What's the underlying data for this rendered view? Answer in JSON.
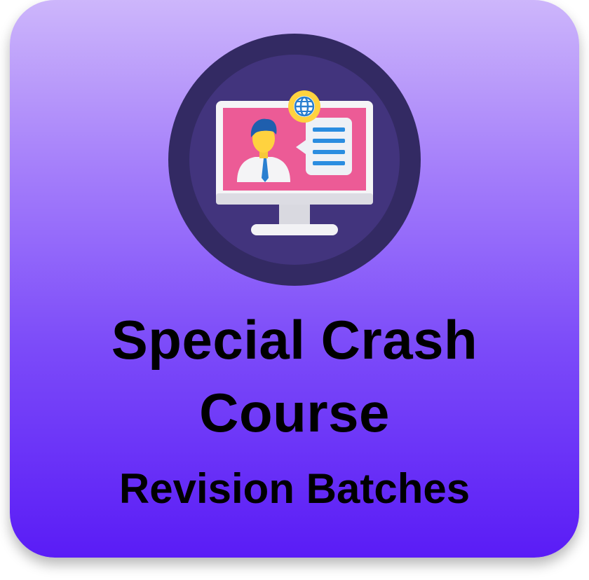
{
  "tile": {
    "title_line1": "Special Crash",
    "title_line2": "Course",
    "subtitle": "Revision Batches"
  },
  "icon": {
    "name": "online-class-monitor-icon",
    "parts": [
      "monitor-icon",
      "presenter-avatar-icon",
      "chat-bubble-icon",
      "globe-icon"
    ]
  },
  "colors": {
    "gradient_top": "#cdb6fb",
    "gradient_bottom": "#5a1cf6",
    "circle_outer": "#332a63",
    "circle_inner": "#42347d",
    "screen_pink": "#ec5b96",
    "globe_yellow": "#ffd23f",
    "text": "#000000"
  }
}
